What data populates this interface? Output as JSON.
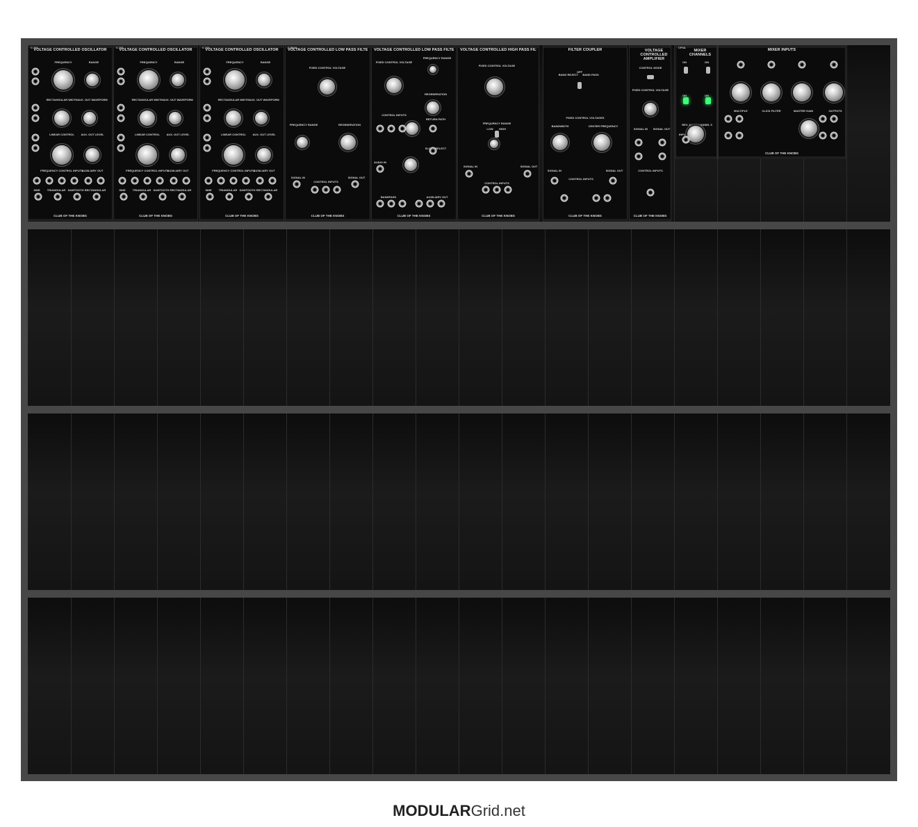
{
  "footer": {
    "brand_bold": "MODULAR",
    "brand_rest": "Grid.net"
  },
  "rack": {
    "rows": 4
  },
  "modules": [
    {
      "code": "C 101",
      "name": "VOLTAGE CONTROLLED OSCILLATOR",
      "brand": "CLUB OF THE KNOBS",
      "labels": [
        "FREQUENCY",
        "RANGE",
        "RECTANGULAR WIDTH",
        "AUX. OUT WAVEFORM",
        "LINEAR CONTROL",
        "AUX. OUT LEVEL",
        "FREQUENCY CONTROL INPUTS",
        "AUXILIARY OUT",
        "SINE",
        "TRIANGULAR",
        "SAWTOOTH",
        "RECTANGULAR"
      ]
    },
    {
      "code": "C 101",
      "name": "VOLTAGE CONTROLLED OSCILLATOR",
      "brand": "CLUB OF THE KNOBS",
      "labels": [
        "FREQUENCY",
        "RANGE",
        "RECTANGULAR WIDTH",
        "AUX. OUT WAVEFORM",
        "LINEAR CONTROL",
        "AUX. OUT LEVEL",
        "FREQUENCY CONTROL INPUTS",
        "AUXILIARY OUT",
        "SINE",
        "TRIANGULAR",
        "SAWTOOTH",
        "RECTANGULAR"
      ]
    },
    {
      "code": "C 101",
      "name": "VOLTAGE CONTROLLED OSCILLATOR",
      "brand": "CLUB OF THE KNOBS",
      "labels": [
        "FREQUENCY",
        "RANGE",
        "RECTANGULAR WIDTH",
        "AUX. OUT WAVEFORM",
        "LINEAR CONTROL",
        "AUX. OUT LEVEL",
        "FREQUENCY CONTROL INPUTS",
        "AUXILIARY OUT",
        "SINE",
        "TRIANGULAR",
        "SAWTOOTH",
        "RECTANGULAR"
      ]
    },
    {
      "code": "C 904A",
      "name": "VOLTAGE CONTROLLED LOW PASS FILTER",
      "brand": "CLUB OF THE KNOBS",
      "labels": [
        "FIXED CONTROL VOLTAGE",
        "FREQUENCY RANGE",
        "REGENERATION",
        "SIGNAL IN",
        "SIGNAL OUT",
        "CONTROL INPUTS"
      ]
    },
    {
      "code": "",
      "name": "VOLTAGE CONTROLLED LOW PASS FILTER",
      "brand": "CLUB OF THE KNOBS",
      "labels": [
        "FIXED CONTROL VOLTAGE",
        "FREQUENCY RANGE",
        "REGENERATION",
        "CONTROL INPUTS",
        "RETURN PATH",
        "SLOPE SELECT",
        "LEVEL",
        "AUDIO IN",
        "BANDPASS",
        "AUXILIARY OUT"
      ]
    },
    {
      "code": "",
      "name": "VOLTAGE CONTROLLED HIGH PASS FILTER",
      "brand": "CLUB OF THE KNOBS",
      "labels": [
        "FIXED CONTROL VOLTAGE",
        "FREQUENCY RANGE",
        "LOW",
        "HIGH",
        "SIGNAL IN",
        "SIGNAL OUT",
        "CONTROL INPUTS"
      ]
    },
    {
      "code": "",
      "name": "FILTER  COUPLER",
      "brand": "CLUB OF THE KNOBS",
      "labels": [
        "BAND REJECT",
        "OFF",
        "BAND PASS",
        "FIXED CONTROL VOLTAGES",
        "BANDWIDTH",
        "CENTER FREQUENCY",
        "SIGNAL IN",
        "SIGNAL OUT",
        "CONTROL INPUTS"
      ]
    },
    {
      "code": "",
      "name": "VOLTAGE CONTROLLED AMPLIFIER",
      "brand": "CLUB OF THE KNOBS",
      "labels": [
        "CONTROL MODE",
        "FIXED CONTROL VOLTAGE",
        "SIGNAL IN",
        "SIGNAL OUT",
        "CONTROL INPUTS"
      ]
    },
    {
      "code": "CP3A",
      "name": "MIXER CHANNELS",
      "brand": "",
      "labels": [
        "ON",
        "ON",
        "ON",
        "ON",
        "REV. AUX. CHANNEL 5",
        "INPUT"
      ]
    },
    {
      "code": "",
      "name": "MIXER INPUTS",
      "brand": "CLUB OF THE KNOBS",
      "labels": [
        "MULTIPLE",
        "CLICK FILTER",
        "MASTER GAIN",
        "OUTPUTS"
      ]
    }
  ]
}
